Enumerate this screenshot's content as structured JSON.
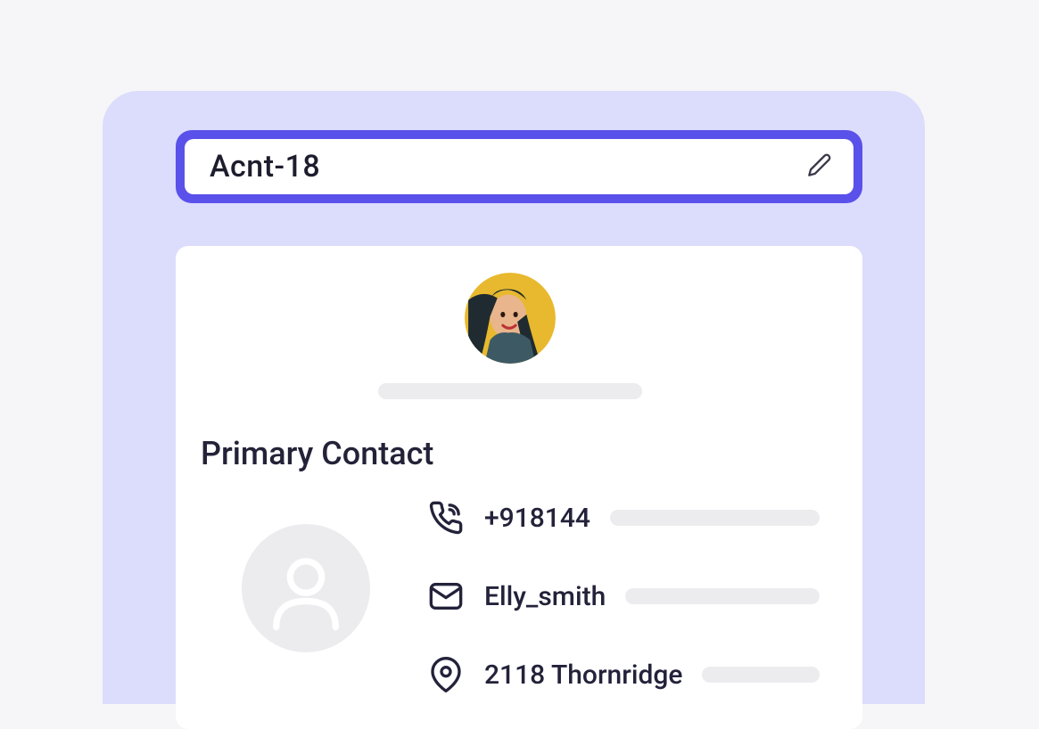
{
  "account": {
    "name": "Acnt-18"
  },
  "contact_card": {
    "section_title": "Primary Contact",
    "phone": "+918144",
    "email": "Elly_smith",
    "address": "2118 Thornridge"
  }
}
